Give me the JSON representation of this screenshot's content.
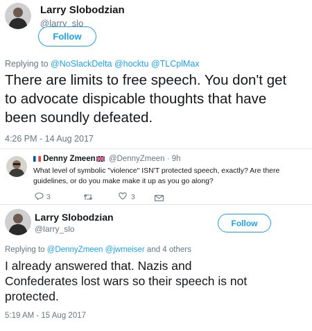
{
  "tweet1": {
    "name": "Larry Slobodzian",
    "handle": "@larry_slo",
    "follow_label": "Follow",
    "replying_prefix": "Replying to",
    "reply_handles": [
      "@NoSlackDelta",
      "@hocktu",
      "@TLCplMax"
    ],
    "text_lines": [
      "There are limits to free speech. You don't get",
      "to advocate dispicable thoughts that have",
      "been soundly defeated."
    ],
    "timestamp": "4:26 PM - 14 Aug 2017"
  },
  "quoted": {
    "name": "Denny Zmeen",
    "handle": "@DennyZmeen",
    "age": "· 9h",
    "text_lines": [
      "What level of symbolic \"violence\" ISN'T protected speech, exactly? Are there",
      "guidelines, or do you make make it up as you go along?"
    ],
    "reply_count": "3",
    "like_count": "3",
    "colors": {
      "heart": "#657786",
      "flag_blue": "#0055a4",
      "flag_red": "#ef4135"
    }
  },
  "tweet2": {
    "name": "Larry Slobodzian",
    "handle": "@larry_slo",
    "follow_label": "Follow",
    "replying_prefix": "Replying to",
    "reply_handles": [
      "@DennyZmeen",
      "@jwmeiser"
    ],
    "reply_suffix": "and 4 others",
    "text_lines": [
      "I already answered that. Nazis and",
      "Confederates lost wars so their speech is not",
      "protected."
    ],
    "timestamp": "5:19 AM - 15 Aug 2017"
  },
  "theme": {
    "accent": "#1da1f2",
    "muted": "#657786",
    "text": "#14171a"
  }
}
